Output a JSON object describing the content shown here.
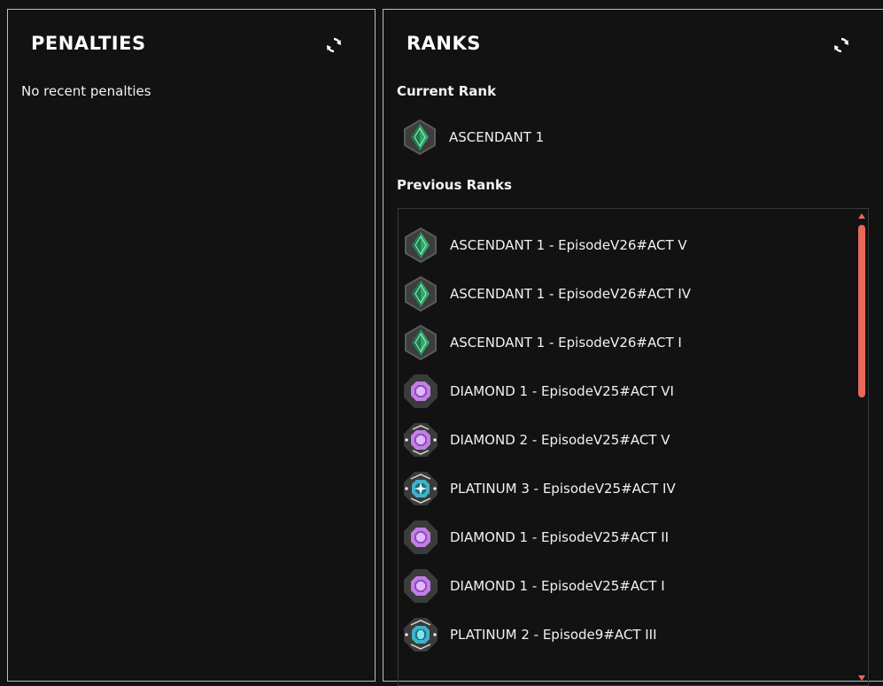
{
  "penalties": {
    "title": "PENALTIES",
    "empty_text": "No recent penalties"
  },
  "ranks": {
    "title": "RANKS",
    "current_label": "Current Rank",
    "current": {
      "name": "ASCENDANT 1",
      "tier": "ascendant"
    },
    "previous_label": "Previous Ranks",
    "previous": [
      {
        "name": "ASCENDANT 1 - EpisodeV26#ACT V",
        "tier": "ascendant"
      },
      {
        "name": "ASCENDANT 1 - EpisodeV26#ACT IV",
        "tier": "ascendant"
      },
      {
        "name": "ASCENDANT 1 - EpisodeV26#ACT I",
        "tier": "ascendant"
      },
      {
        "name": "DIAMOND 1 - EpisodeV25#ACT VI",
        "tier": "diamond1"
      },
      {
        "name": "DIAMOND 2 - EpisodeV25#ACT V",
        "tier": "diamond2"
      },
      {
        "name": "PLATINUM 3 - EpisodeV25#ACT IV",
        "tier": "platinum3"
      },
      {
        "name": "DIAMOND 1 - EpisodeV25#ACT II",
        "tier": "diamond1"
      },
      {
        "name": "DIAMOND 1 - EpisodeV25#ACT I",
        "tier": "diamond1"
      },
      {
        "name": "PLATINUM 2 - Episode9#ACT III",
        "tier": "platinum2"
      }
    ]
  },
  "colors": {
    "accent": "#e8685a",
    "ascendant": "#2fa86a",
    "diamond": "#c27fe6",
    "platinum": "#3fb2c8"
  },
  "icons": {
    "refresh": "refresh-icon",
    "rank": "rank-badge-icon"
  }
}
